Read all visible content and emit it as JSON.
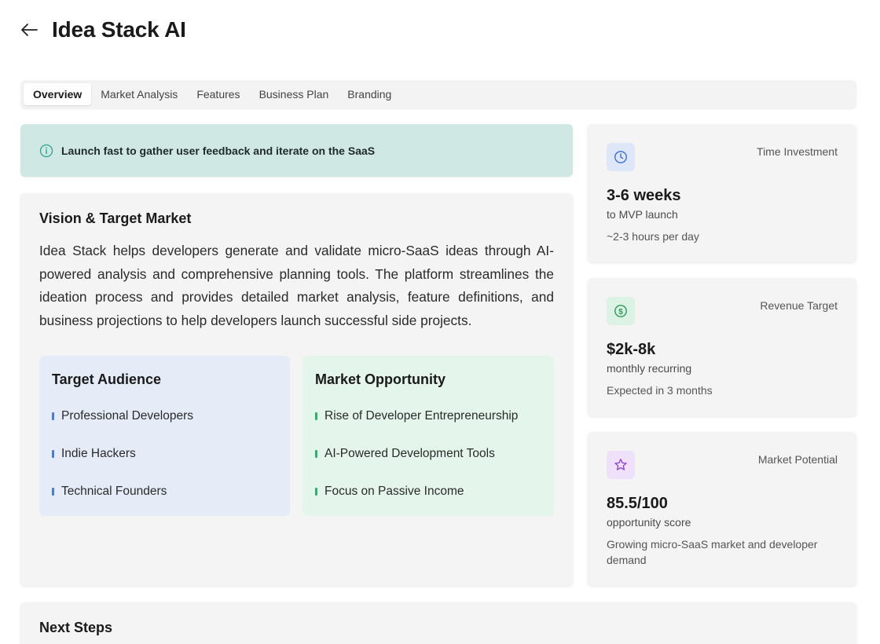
{
  "header": {
    "title": "Idea Stack AI"
  },
  "tabs": [
    {
      "label": "Overview"
    },
    {
      "label": "Market Analysis"
    },
    {
      "label": "Features"
    },
    {
      "label": "Business Plan"
    },
    {
      "label": "Branding"
    }
  ],
  "banner": {
    "text": "Launch fast to gather user feedback and iterate on the SaaS"
  },
  "vision": {
    "title": "Vision & Target Market",
    "text": "Idea Stack helps developers generate and validate micro-SaaS ideas through AI-powered analysis and comprehensive planning tools. The platform streamlines the ideation process and provides detailed market analysis, feature definitions, and business projections to help developers launch successful side projects.",
    "audience": {
      "title": "Target Audience",
      "items": [
        "Professional Developers",
        "Indie Hackers",
        "Technical Founders"
      ]
    },
    "market": {
      "title": "Market Opportunity",
      "items": [
        "Rise of Developer Entrepreneurship",
        "AI-Powered Development Tools",
        "Focus on Passive Income"
      ]
    }
  },
  "stats": {
    "time": {
      "label": "Time Investment",
      "value": "3-6 weeks",
      "unit": "to MVP launch",
      "note": "~2-3 hours per day"
    },
    "revenue": {
      "label": "Revenue Target",
      "value": "$2k-8k",
      "unit": "monthly recurring",
      "note": "Expected in 3 months"
    },
    "potential": {
      "label": "Market Potential",
      "value": "85.5/100",
      "unit": "opportunity score",
      "note": "Growing micro-SaaS market and developer demand"
    }
  },
  "next_steps": {
    "title": "Next Steps"
  },
  "colors": {
    "banner_bg": "#cfe8e4",
    "audience_bg": "#e5ecf8",
    "market_bg": "#e4f6ec",
    "time_icon": "#3b6fd4",
    "revenue_icon": "#2a9a5a",
    "potential_icon": "#8b3fd8"
  }
}
